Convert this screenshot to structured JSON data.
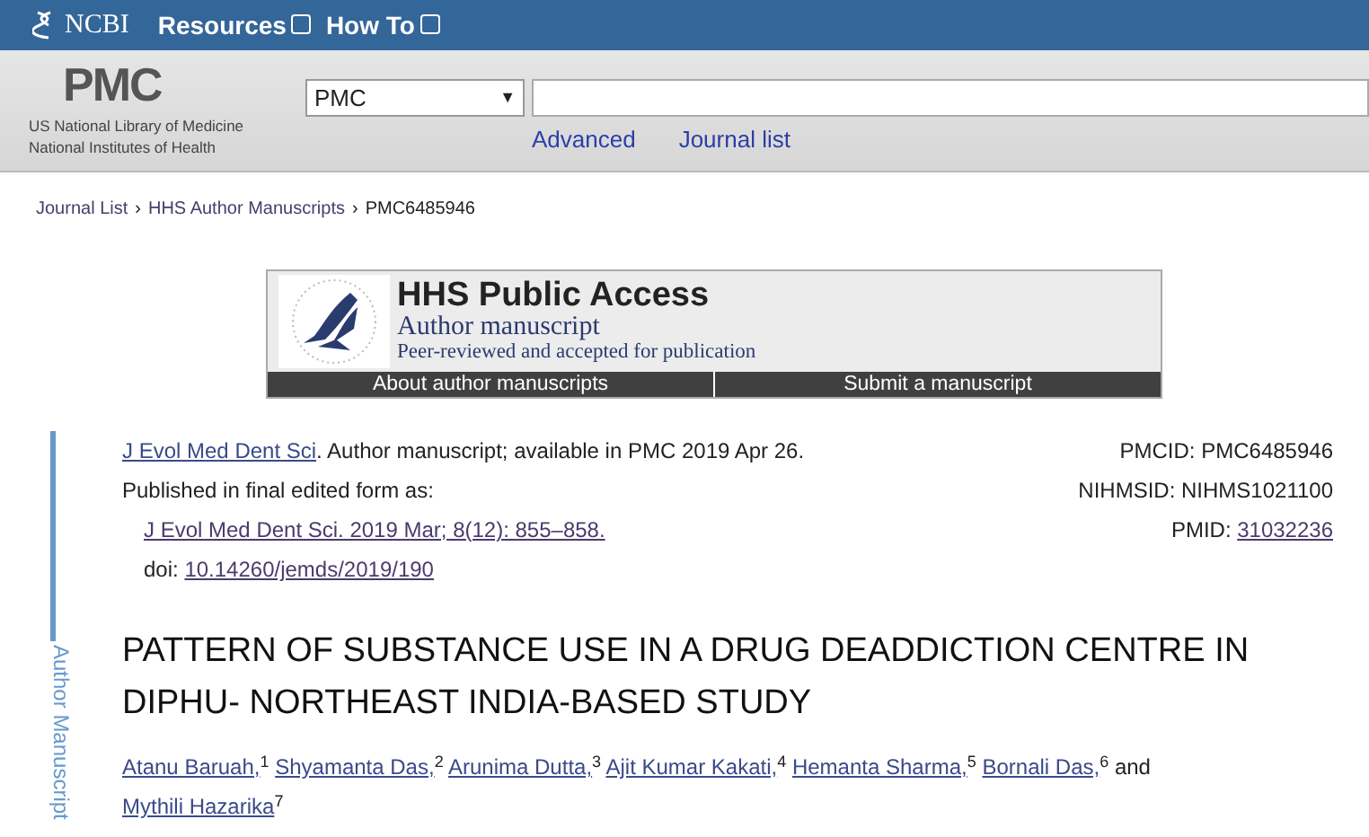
{
  "topbar": {
    "brand": "NCBI",
    "menus": [
      {
        "label": "Resources"
      },
      {
        "label": "How To"
      }
    ]
  },
  "masthead": {
    "logo": "PMC",
    "org_lines": [
      "US National Library of Medicine",
      "National Institutes of Health"
    ],
    "database": "PMC",
    "database_caret": "▼",
    "links": [
      "Advanced",
      "Journal list"
    ]
  },
  "breadcrumb_separator": "›",
  "breadcrumb": [
    {
      "label": "Journal List",
      "link": true
    },
    {
      "label": "HHS Author Manuscripts",
      "link": true
    },
    {
      "label": "PMC6485946",
      "link": false
    }
  ],
  "banner": {
    "title": "HHS Public Access",
    "subtitle": "Author manuscript",
    "tagline": "Peer-reviewed and accepted for publication",
    "buttons": [
      "About author manuscripts",
      "Submit a manuscript"
    ]
  },
  "side_label": "Author Manuscript",
  "citation": {
    "journal": "J Evol Med Dent Sci",
    "availability": ". Author manuscript; available in PMC 2019 Apr 26.",
    "published_label": "Published in final edited form as:",
    "published_ref": "J Evol Med Dent Sci. 2019 Mar; 8(12): 855–858.",
    "doi_label": "doi: ",
    "doi": "10.14260/jemds/2019/190"
  },
  "ids": [
    {
      "label": "PMCID: ",
      "value": "PMC6485946",
      "link": false
    },
    {
      "label": "NIHMSID: ",
      "value": "NIHMS1021100",
      "link": false
    },
    {
      "label": "PMID: ",
      "value": "31032236",
      "link": true
    }
  ],
  "title": "PATTERN OF SUBSTANCE USE IN A DRUG DEADDICTION CENTRE IN DIPHU- NORTHEAST INDIA-BASED STUDY",
  "authors": [
    {
      "name": "Atanu Baruah,",
      "affiliation": "1"
    },
    {
      "name": "Shyamanta Das,",
      "affiliation": "2"
    },
    {
      "name": "Arunima Dutta,",
      "affiliation": "3"
    },
    {
      "name": "Ajit Kumar Kakati,",
      "affiliation": "4"
    },
    {
      "name": "Hemanta Sharma,",
      "affiliation": "5"
    },
    {
      "name": "Bornali Das,",
      "affiliation": "6"
    },
    {
      "name": "Mythili Hazarika",
      "affiliation": "7"
    }
  ],
  "authors_conjunction": "and"
}
